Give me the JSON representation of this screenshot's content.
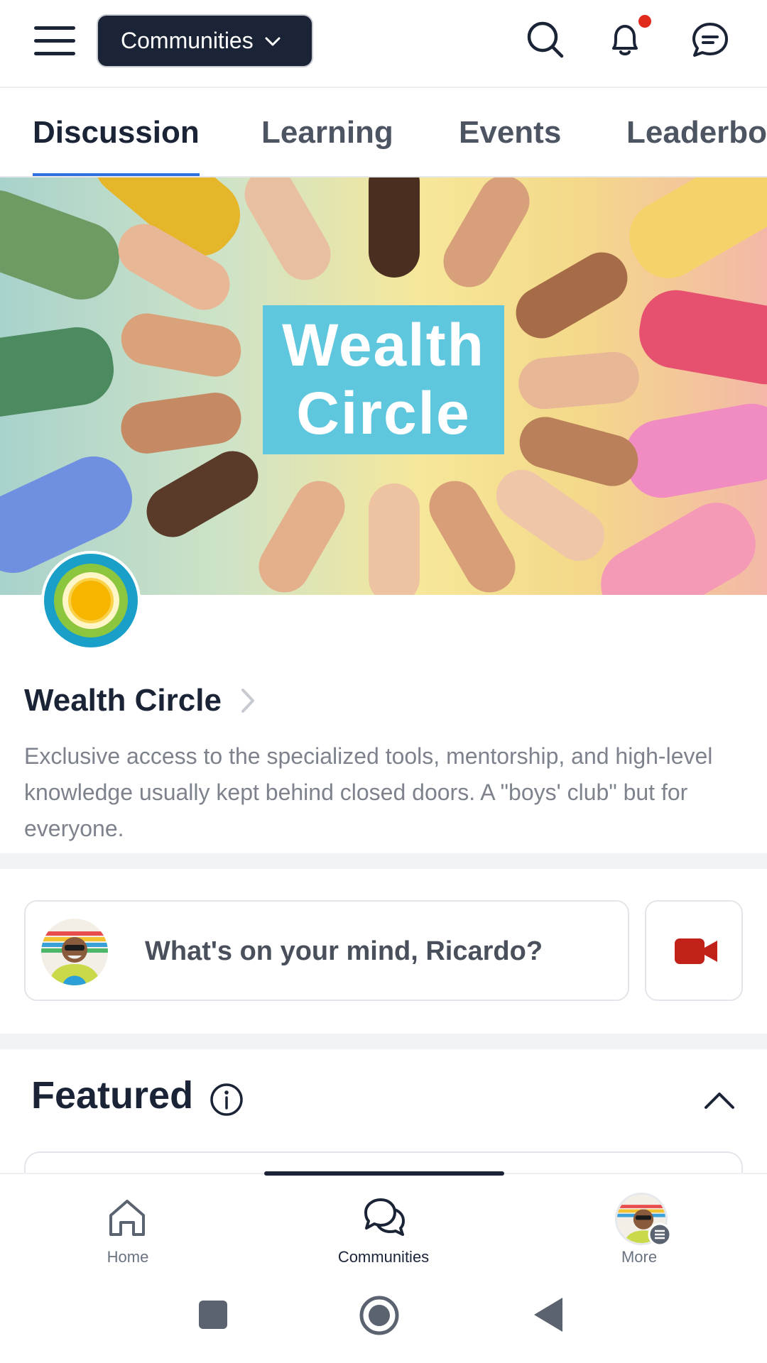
{
  "header": {
    "community_selector_label": "Communities",
    "icons": [
      "menu-icon",
      "search-icon",
      "bell-icon",
      "chat-icon"
    ],
    "has_unread_notifications": true
  },
  "tabs": [
    {
      "label": "Discussion",
      "active": true
    },
    {
      "label": "Learning",
      "active": false
    },
    {
      "label": "Events",
      "active": false
    },
    {
      "label": "Leaderboa",
      "active": false
    }
  ],
  "banner": {
    "title_line1": "Wealth",
    "title_line2": "Circle"
  },
  "community": {
    "name": "Wealth Circle",
    "description": "Exclusive access to the specialized tools, mentorship, and high-level knowledge usually kept behind closed doors. A \"boys' club\" but for everyone."
  },
  "composer": {
    "placeholder": "What's on your mind, Ricardo?"
  },
  "featured": {
    "title": "Featured"
  },
  "bottom_nav": [
    {
      "label": "Home",
      "icon": "home-icon",
      "active": false
    },
    {
      "label": "Communities",
      "icon": "communities-icon",
      "active": true
    },
    {
      "label": "More",
      "icon": "avatar-menu-icon",
      "active": false
    }
  ],
  "colors": {
    "primary_dark": "#1b2436",
    "tab_indicator": "#2f6fdf",
    "notification_dot": "#e02a1b",
    "video_icon": "#c0221a",
    "banner_title_bg": "#5ec6dd"
  }
}
